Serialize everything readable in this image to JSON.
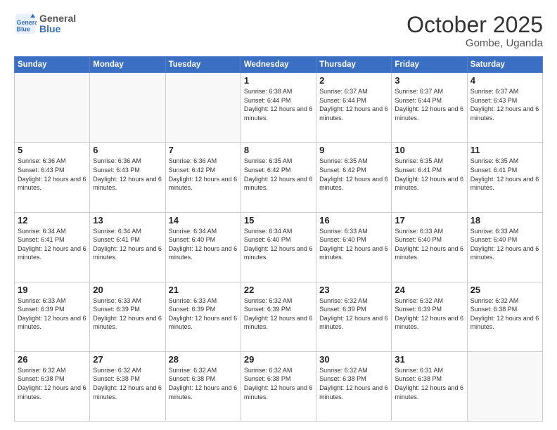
{
  "header": {
    "logo_line1": "General",
    "logo_line2": "Blue",
    "month": "October 2025",
    "location": "Gombe, Uganda"
  },
  "weekdays": [
    "Sunday",
    "Monday",
    "Tuesday",
    "Wednesday",
    "Thursday",
    "Friday",
    "Saturday"
  ],
  "weeks": [
    [
      {
        "day": "",
        "info": ""
      },
      {
        "day": "",
        "info": ""
      },
      {
        "day": "",
        "info": ""
      },
      {
        "day": "1",
        "info": "Sunrise: 6:38 AM\nSunset: 6:44 PM\nDaylight: 12 hours and 6 minutes."
      },
      {
        "day": "2",
        "info": "Sunrise: 6:37 AM\nSunset: 6:44 PM\nDaylight: 12 hours and 6 minutes."
      },
      {
        "day": "3",
        "info": "Sunrise: 6:37 AM\nSunset: 6:44 PM\nDaylight: 12 hours and 6 minutes."
      },
      {
        "day": "4",
        "info": "Sunrise: 6:37 AM\nSunset: 6:43 PM\nDaylight: 12 hours and 6 minutes."
      }
    ],
    [
      {
        "day": "5",
        "info": "Sunrise: 6:36 AM\nSunset: 6:43 PM\nDaylight: 12 hours and 6 minutes."
      },
      {
        "day": "6",
        "info": "Sunrise: 6:36 AM\nSunset: 6:43 PM\nDaylight: 12 hours and 6 minutes."
      },
      {
        "day": "7",
        "info": "Sunrise: 6:36 AM\nSunset: 6:42 PM\nDaylight: 12 hours and 6 minutes."
      },
      {
        "day": "8",
        "info": "Sunrise: 6:35 AM\nSunset: 6:42 PM\nDaylight: 12 hours and 6 minutes."
      },
      {
        "day": "9",
        "info": "Sunrise: 6:35 AM\nSunset: 6:42 PM\nDaylight: 12 hours and 6 minutes."
      },
      {
        "day": "10",
        "info": "Sunrise: 6:35 AM\nSunset: 6:41 PM\nDaylight: 12 hours and 6 minutes."
      },
      {
        "day": "11",
        "info": "Sunrise: 6:35 AM\nSunset: 6:41 PM\nDaylight: 12 hours and 6 minutes."
      }
    ],
    [
      {
        "day": "12",
        "info": "Sunrise: 6:34 AM\nSunset: 6:41 PM\nDaylight: 12 hours and 6 minutes."
      },
      {
        "day": "13",
        "info": "Sunrise: 6:34 AM\nSunset: 6:41 PM\nDaylight: 12 hours and 6 minutes."
      },
      {
        "day": "14",
        "info": "Sunrise: 6:34 AM\nSunset: 6:40 PM\nDaylight: 12 hours and 6 minutes."
      },
      {
        "day": "15",
        "info": "Sunrise: 6:34 AM\nSunset: 6:40 PM\nDaylight: 12 hours and 6 minutes."
      },
      {
        "day": "16",
        "info": "Sunrise: 6:33 AM\nSunset: 6:40 PM\nDaylight: 12 hours and 6 minutes."
      },
      {
        "day": "17",
        "info": "Sunrise: 6:33 AM\nSunset: 6:40 PM\nDaylight: 12 hours and 6 minutes."
      },
      {
        "day": "18",
        "info": "Sunrise: 6:33 AM\nSunset: 6:40 PM\nDaylight: 12 hours and 6 minutes."
      }
    ],
    [
      {
        "day": "19",
        "info": "Sunrise: 6:33 AM\nSunset: 6:39 PM\nDaylight: 12 hours and 6 minutes."
      },
      {
        "day": "20",
        "info": "Sunrise: 6:33 AM\nSunset: 6:39 PM\nDaylight: 12 hours and 6 minutes."
      },
      {
        "day": "21",
        "info": "Sunrise: 6:33 AM\nSunset: 6:39 PM\nDaylight: 12 hours and 6 minutes."
      },
      {
        "day": "22",
        "info": "Sunrise: 6:32 AM\nSunset: 6:39 PM\nDaylight: 12 hours and 6 minutes."
      },
      {
        "day": "23",
        "info": "Sunrise: 6:32 AM\nSunset: 6:39 PM\nDaylight: 12 hours and 6 minutes."
      },
      {
        "day": "24",
        "info": "Sunrise: 6:32 AM\nSunset: 6:39 PM\nDaylight: 12 hours and 6 minutes."
      },
      {
        "day": "25",
        "info": "Sunrise: 6:32 AM\nSunset: 6:38 PM\nDaylight: 12 hours and 6 minutes."
      }
    ],
    [
      {
        "day": "26",
        "info": "Sunrise: 6:32 AM\nSunset: 6:38 PM\nDaylight: 12 hours and 6 minutes."
      },
      {
        "day": "27",
        "info": "Sunrise: 6:32 AM\nSunset: 6:38 PM\nDaylight: 12 hours and 6 minutes."
      },
      {
        "day": "28",
        "info": "Sunrise: 6:32 AM\nSunset: 6:38 PM\nDaylight: 12 hours and 6 minutes."
      },
      {
        "day": "29",
        "info": "Sunrise: 6:32 AM\nSunset: 6:38 PM\nDaylight: 12 hours and 6 minutes."
      },
      {
        "day": "30",
        "info": "Sunrise: 6:32 AM\nSunset: 6:38 PM\nDaylight: 12 hours and 6 minutes."
      },
      {
        "day": "31",
        "info": "Sunrise: 6:31 AM\nSunset: 6:38 PM\nDaylight: 12 hours and 6 minutes."
      },
      {
        "day": "",
        "info": ""
      }
    ]
  ]
}
